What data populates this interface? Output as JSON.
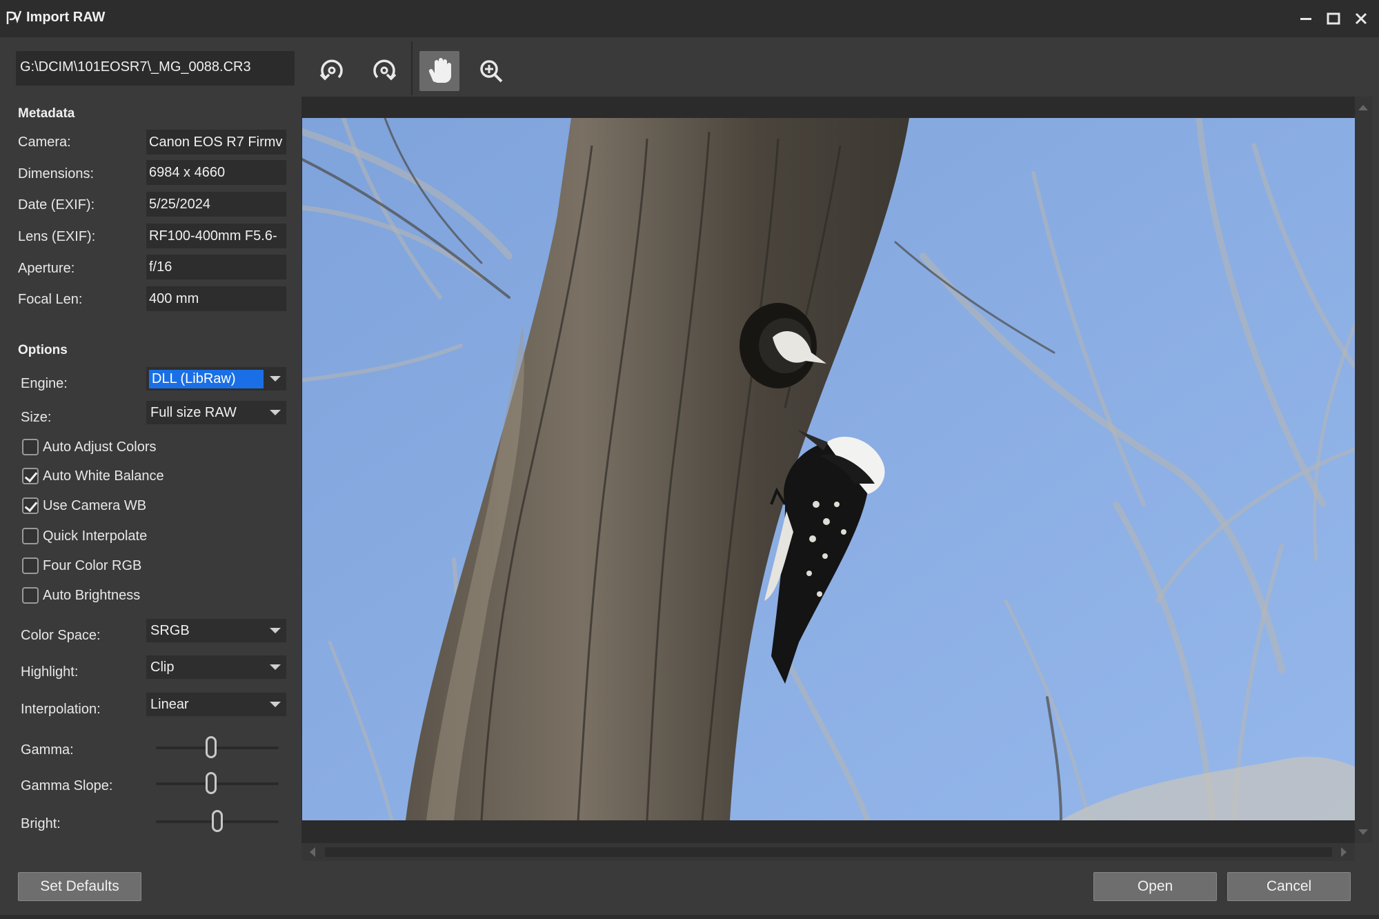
{
  "window": {
    "title": "Import RAW",
    "icons": {
      "logo": "app-logo-icon",
      "minimize": "minimize-icon",
      "maximize": "maximize-icon",
      "close": "close-icon"
    }
  },
  "file": {
    "path": "G:\\DCIM\\101EOSR7\\_MG_0088.CR3"
  },
  "metadata": {
    "title": "Metadata",
    "rows": [
      {
        "label": "Camera:",
        "value": "Canon EOS R7 Firmv"
      },
      {
        "label": "Dimensions:",
        "value": "6984 x 4660"
      },
      {
        "label": "Date (EXIF):",
        "value": "5/25/2024"
      },
      {
        "label": "Lens (EXIF):",
        "value": "RF100-400mm F5.6-"
      },
      {
        "label": "Aperture:",
        "value": "f/16"
      },
      {
        "label": "Focal Len:",
        "value": "400 mm"
      }
    ]
  },
  "options": {
    "title": "Options",
    "engine": {
      "label": "Engine:",
      "value": "DLL (LibRaw)"
    },
    "size": {
      "label": "Size:",
      "value": "Full size RAW"
    },
    "checkboxes": [
      {
        "label": "Auto Adjust Colors",
        "checked": false
      },
      {
        "label": "Auto White Balance",
        "checked": true
      },
      {
        "label": "Use Camera WB",
        "checked": true
      },
      {
        "label": "Quick Interpolate",
        "checked": false
      },
      {
        "label": "Four Color RGB",
        "checked": false
      },
      {
        "label": "Auto Brightness",
        "checked": false
      }
    ],
    "color_space": {
      "label": "Color Space:",
      "value": "SRGB"
    },
    "highlight": {
      "label": "Highlight:",
      "value": "Clip"
    },
    "interpolation": {
      "label": "Interpolation:",
      "value": "Linear"
    },
    "sliders": [
      {
        "label": "Gamma:",
        "level": 0.45
      },
      {
        "label": "Gamma Slope:",
        "level": 0.45
      },
      {
        "label": "Bright:",
        "level": 0.5
      }
    ]
  },
  "toolbar": {
    "tools": [
      {
        "name": "rotate-left-icon",
        "active": false
      },
      {
        "name": "rotate-right-icon",
        "active": false
      },
      {
        "name": "hand-pan-icon",
        "active": true
      },
      {
        "name": "zoom-in-icon",
        "active": false
      }
    ]
  },
  "buttons": {
    "set_defaults": "Set Defaults",
    "open": "Open",
    "cancel": "Cancel"
  },
  "colors": {
    "accent": "#1a6fe6",
    "sky": "#8aaee3",
    "background": "#3a3a3a",
    "titlebar": "#2d2d2d"
  }
}
